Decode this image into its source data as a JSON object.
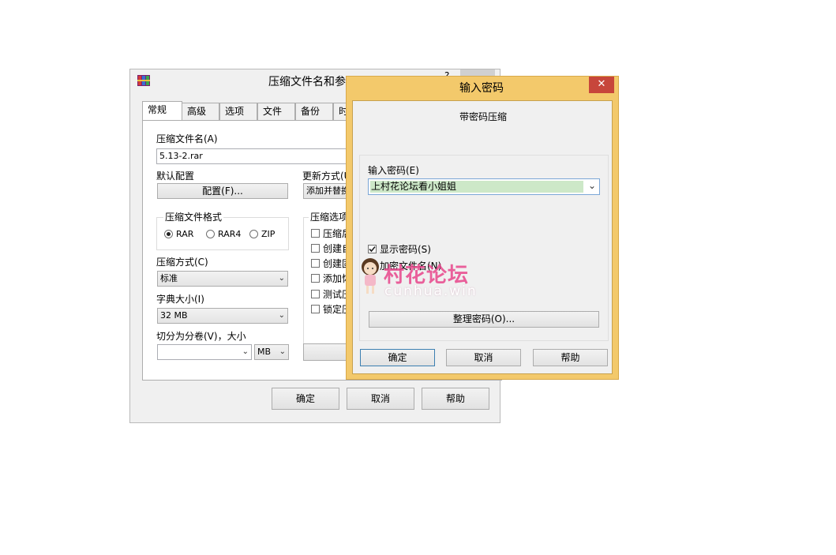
{
  "back_window": {
    "title": "压缩文件名和参",
    "tabs": [
      "常规",
      "高级",
      "选项",
      "文件",
      "备份",
      "时"
    ],
    "archive_name_label": "压缩文件名(A)",
    "archive_name_value": "5.13-2.rar",
    "default_profile_label": "默认配置",
    "profile_button": "配置(F)...",
    "update_mode_label": "更新方式(U",
    "update_mode_value": "添加并替换",
    "format_group_label": "压缩文件格式",
    "formats": [
      "RAR",
      "RAR4",
      "ZIP"
    ],
    "selected_format": "RAR",
    "options_group_label": "压缩选项",
    "options": [
      "压缩后",
      "创建自",
      "创建固",
      "添加恢",
      "测试压",
      "锁定压"
    ],
    "method_label": "压缩方式(C)",
    "method_value": "标准",
    "dict_label": "字典大小(I)",
    "dict_value": "32 MB",
    "split_label": "切分为分卷(V)，大小",
    "split_value": "",
    "split_unit": "MB",
    "ok": "确定",
    "cancel": "取消",
    "help": "帮助",
    "title_glyph": "?"
  },
  "password_dialog": {
    "title": "输入密码",
    "close": "✕",
    "heading": "带密码压缩",
    "password_label": "输入密码(E)",
    "password_value": "上村花论坛看小姐姐",
    "show_password_label": "显示密码(S)",
    "show_password_checked": true,
    "encrypt_names_label": "加密文件名(N)",
    "encrypt_names_checked": false,
    "organize_button": "整理密码(O)...",
    "ok": "确定",
    "cancel": "取消",
    "help": "帮助"
  },
  "watermark": {
    "title": "村花论坛",
    "url": "cunhua.win"
  },
  "colors": {
    "dialog_frame": "#f3c96b",
    "close_button": "#c7463b",
    "password_field_bg": "#cde8c8",
    "watermark": "#e8468c"
  }
}
